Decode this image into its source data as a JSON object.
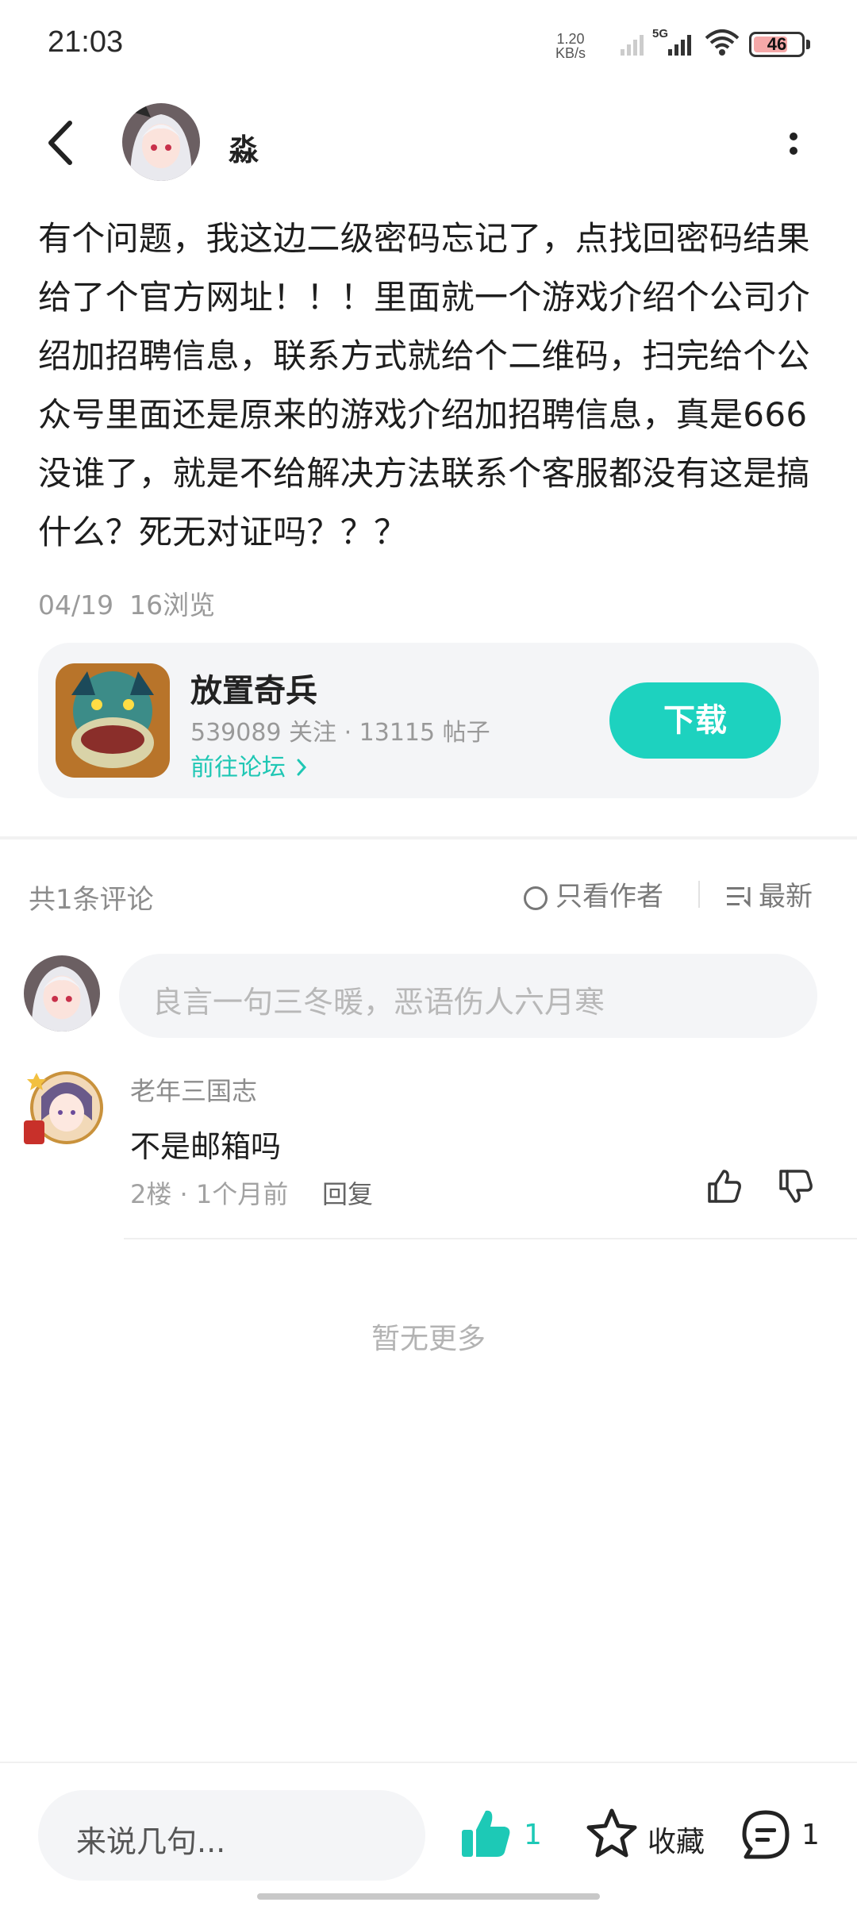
{
  "status_bar": {
    "time": "21:03",
    "net_speed_value": "1.20",
    "net_speed_unit": "KB/s",
    "network_type": "5G",
    "battery": "46"
  },
  "header": {
    "author_name": "淼"
  },
  "post": {
    "content": "有个问题，我这边二级密码忘记了，点找回密码结果给了个官方网址！！！里面就一个游戏介绍个公司介绍加招聘信息，联系方式就给个二维码，扫完给个公众号里面还是原来的游戏介绍加招聘信息，真是666没谁了，就是不给解决方法联系个客服都没有这是搞什么？死无对证吗？？？",
    "date": "04/19",
    "views": "16浏览"
  },
  "game_card": {
    "name": "放置奇兵",
    "stats": "539089 关注 · 13115 帖子",
    "forum_link": "前往论坛",
    "download_label": "下载"
  },
  "comments_header": {
    "count_label": "共1条评论",
    "author_only_label": "只看作者",
    "sort_label": "最新"
  },
  "comment_input": {
    "placeholder": "良言一句三冬暖，恶语伤人六月寒"
  },
  "comments": [
    {
      "author": "老年三国志",
      "text": "不是邮箱吗",
      "meta": "2楼 · 1个月前",
      "reply_label": "回复"
    }
  ],
  "no_more_label": "暂无更多",
  "bottom_bar": {
    "input_placeholder": "来说几句...",
    "like_count": "1",
    "favorite_label": "收藏",
    "comment_count": "1"
  },
  "colors": {
    "accent": "#1dd2bf",
    "text_primary": "#1e1e1e",
    "text_secondary": "#9a9a9a",
    "card_bg": "#f4f5f7"
  }
}
